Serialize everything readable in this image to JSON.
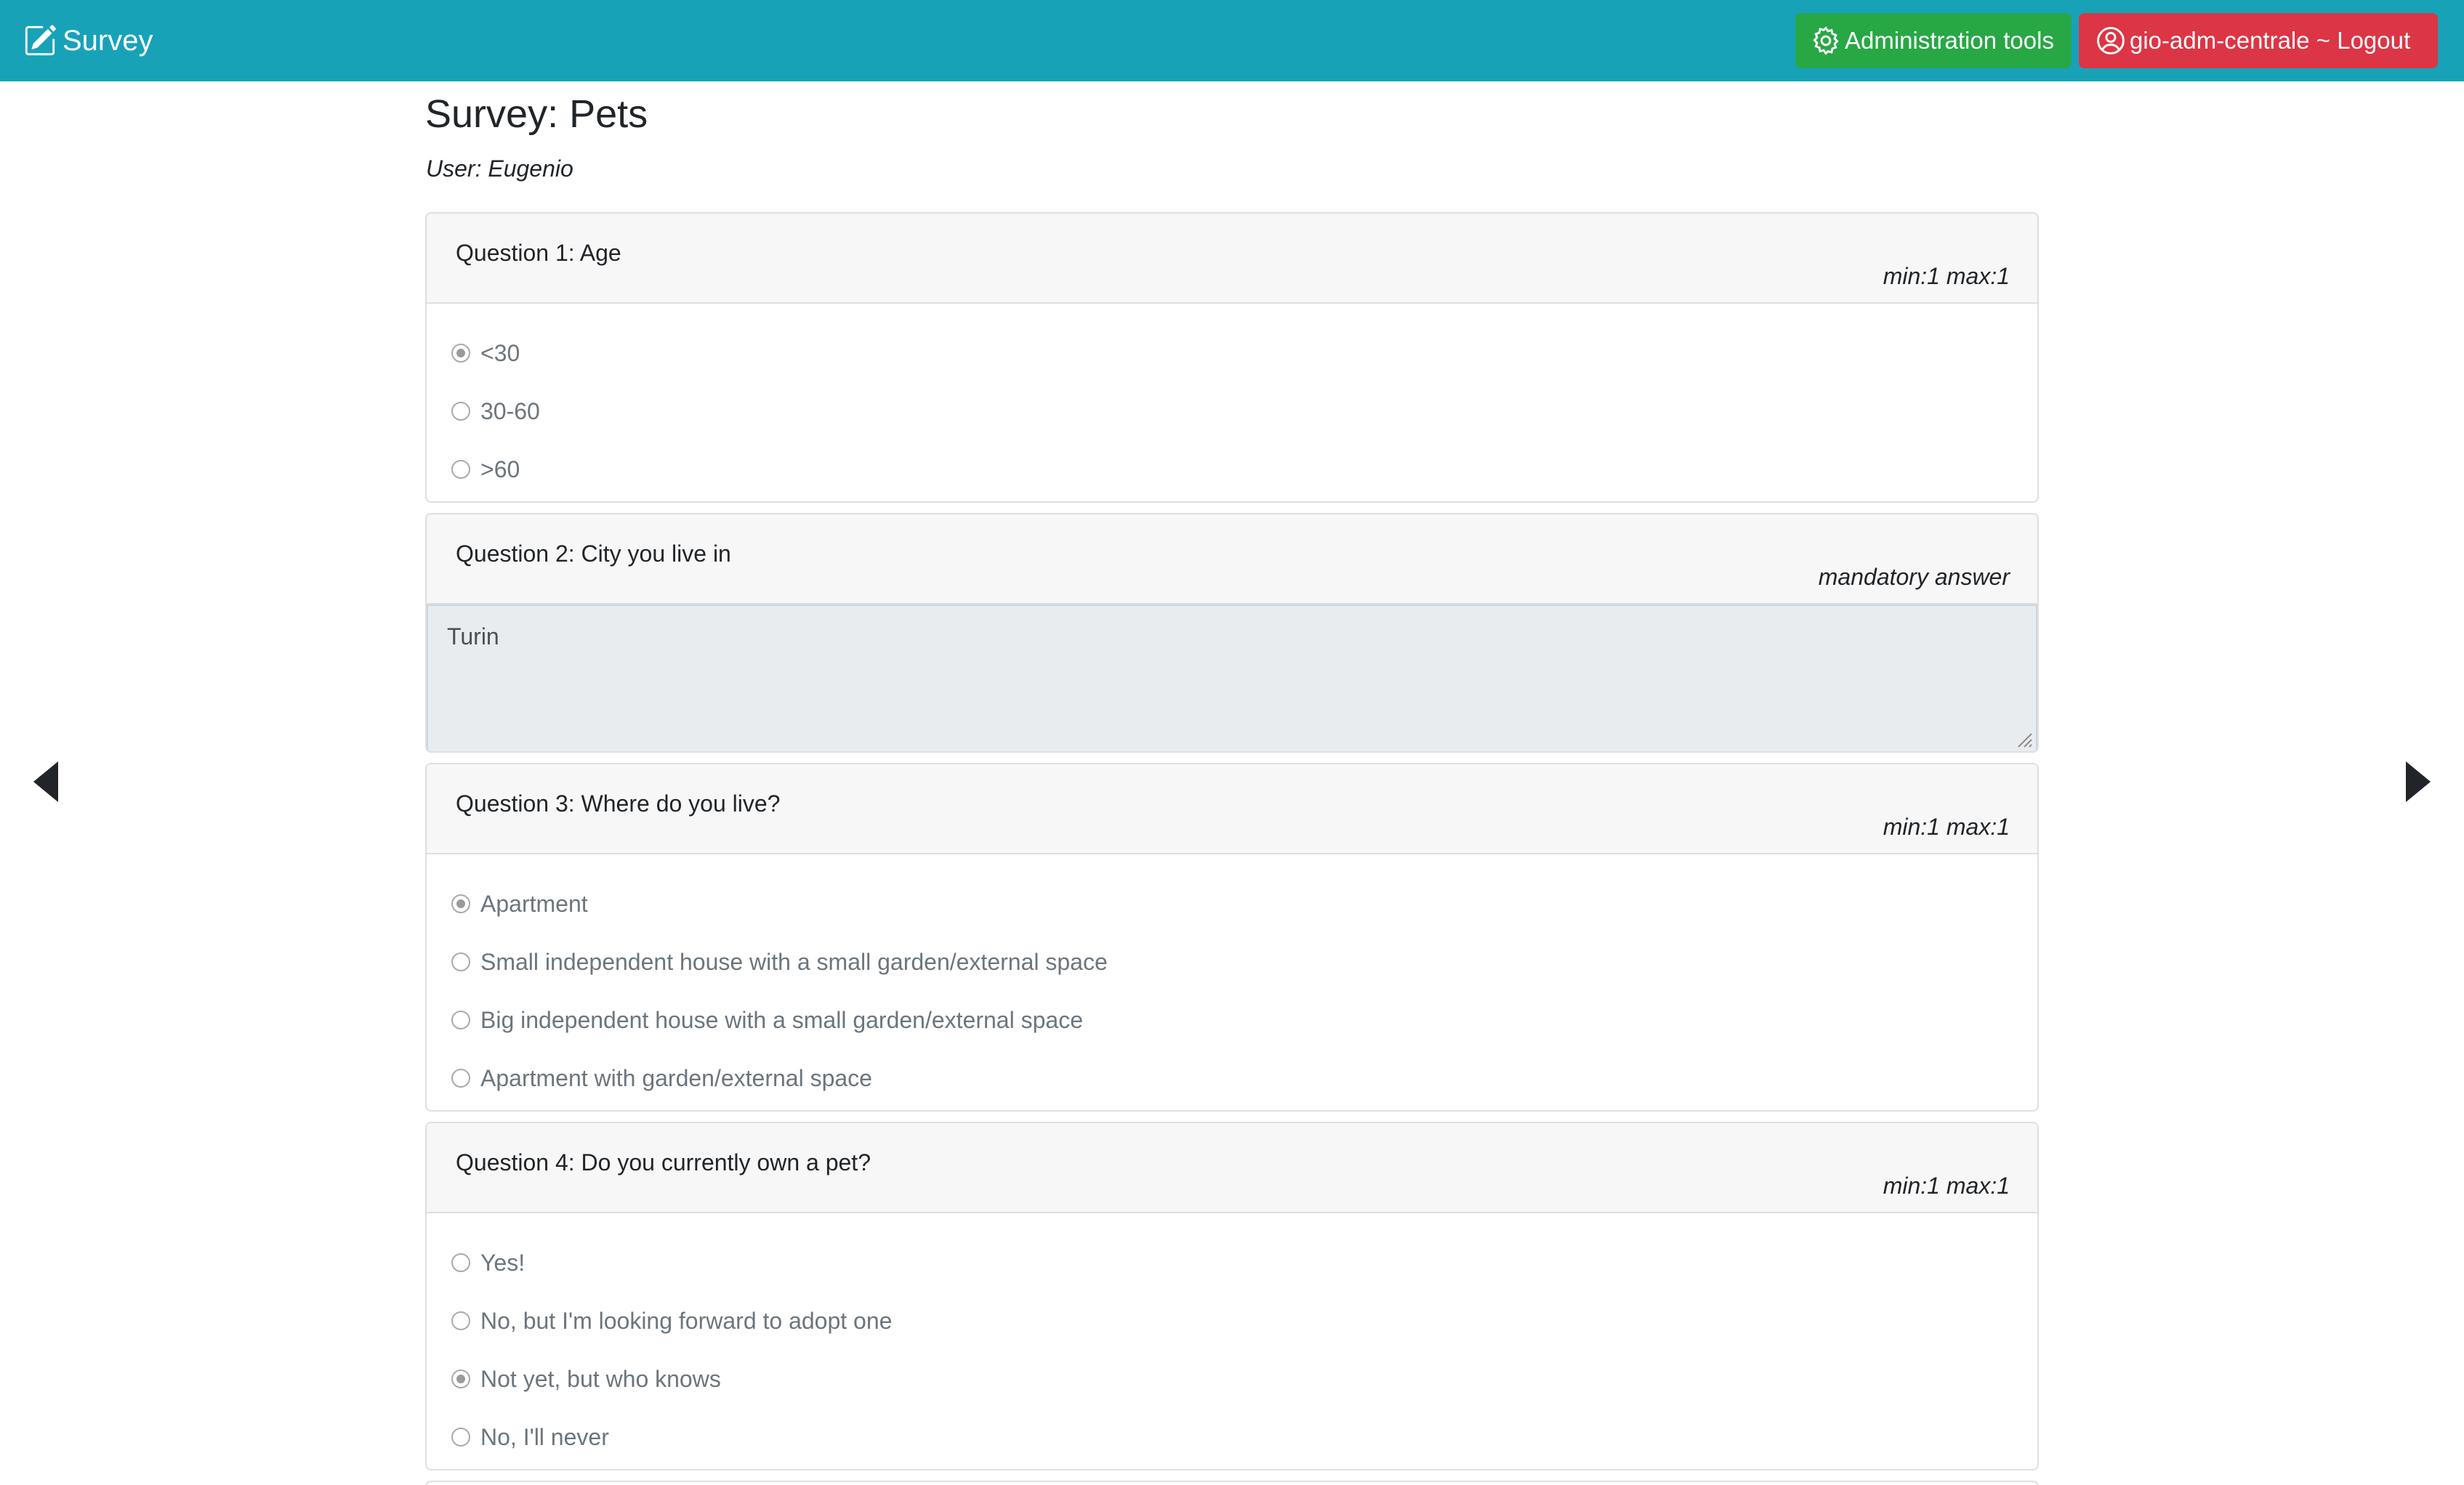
{
  "navbar": {
    "brand": "Survey",
    "admin_label": "Administration tools",
    "logout_label": "gio-adm-centrale ~ Logout"
  },
  "page": {
    "title": "Survey: Pets",
    "user": "User: Eugenio"
  },
  "questions": [
    {
      "title": "Question 1: Age",
      "meta": "min:1 max:1",
      "options": [
        {
          "label": "<30",
          "checked": true
        },
        {
          "label": "30-60",
          "checked": false
        },
        {
          "label": ">60",
          "checked": false
        }
      ]
    },
    {
      "title": "Question 2: City you live in",
      "meta": "mandatory answer",
      "answer": "Turin"
    },
    {
      "title": "Question 3: Where do you live?",
      "meta": "min:1 max:1",
      "options": [
        {
          "label": "Apartment",
          "checked": true
        },
        {
          "label": "Small independent house with a small garden/external space",
          "checked": false
        },
        {
          "label": "Big independent house with a small garden/external space",
          "checked": false
        },
        {
          "label": "Apartment with garden/external space",
          "checked": false
        }
      ]
    },
    {
      "title": "Question 4: Do you currently own a pet?",
      "meta": "min:1 max:1",
      "options": [
        {
          "label": "Yes!",
          "checked": false
        },
        {
          "label": "No, but I'm looking forward to adopt one",
          "checked": false
        },
        {
          "label": "Not yet, but who knows",
          "checked": true
        },
        {
          "label": "No, I'll never",
          "checked": false
        }
      ]
    }
  ],
  "icons": {
    "brand": "edit-icon",
    "admin": "gear-icon",
    "logout": "user-circle-icon",
    "prev": "caret-left-icon",
    "next": "caret-right-icon"
  },
  "colors": {
    "navbar": "#17a2b8",
    "admin_button": "#28a745",
    "logout_button": "#dc3545"
  }
}
